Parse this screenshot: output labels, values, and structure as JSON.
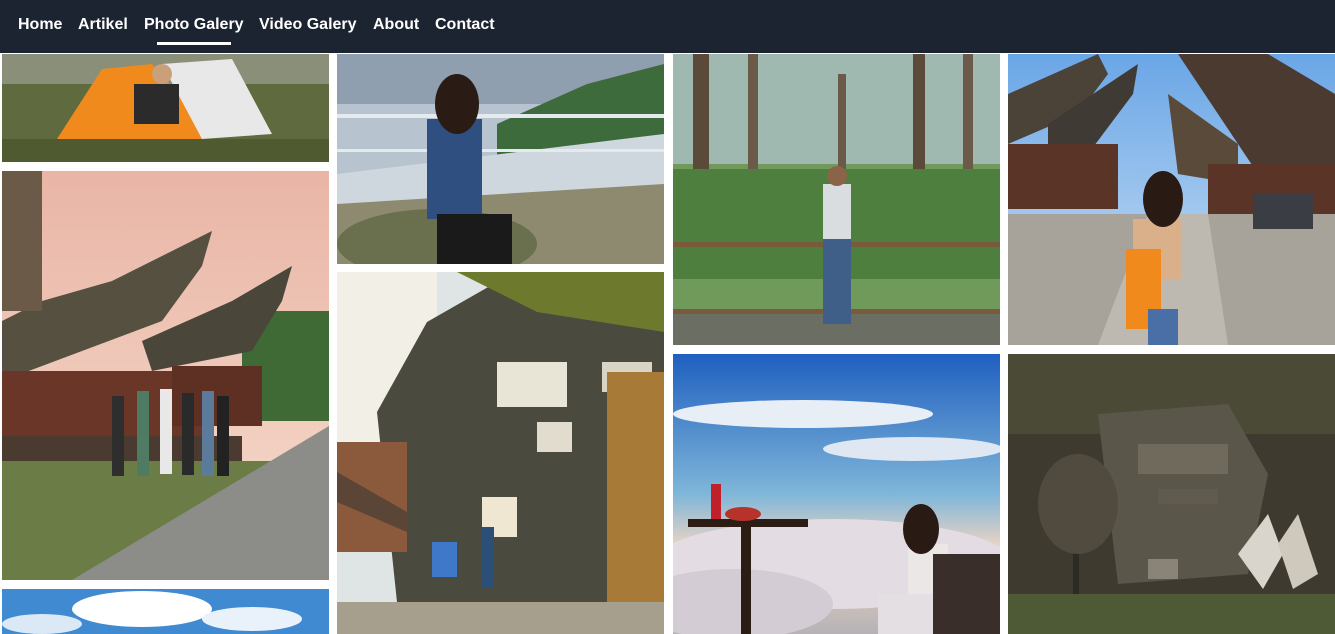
{
  "nav": {
    "items": [
      {
        "label": "Home"
      },
      {
        "label": "Artikel"
      },
      {
        "label": "Photo Galery"
      },
      {
        "label": "Video Galery"
      },
      {
        "label": "About"
      },
      {
        "label": "Contact"
      }
    ],
    "active": "Photo Galery"
  },
  "colors": {
    "navbar_bg": "#1b2430",
    "nav_text": "#ffffff",
    "page_bg": "#ffffff"
  },
  "gallery": {
    "photos": [
      {
        "subject": "camping tent on grass"
      },
      {
        "subject": "group at traditional Toraja houses"
      },
      {
        "subject": "sky photo"
      },
      {
        "subject": "woman at viewpoint railing"
      },
      {
        "subject": "Toraja cliff graves"
      },
      {
        "subject": "man at forest railing"
      },
      {
        "subject": "woman above sea of clouds"
      },
      {
        "subject": "woman in Toraja village street"
      },
      {
        "subject": "cliff graves with tongkonan"
      }
    ]
  }
}
